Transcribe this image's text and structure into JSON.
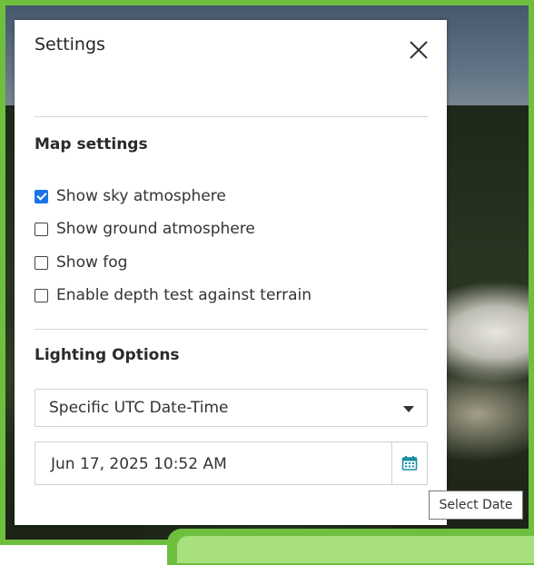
{
  "dialog": {
    "title": "Settings",
    "close_icon": "close-icon"
  },
  "map_settings": {
    "heading": "Map settings",
    "options": [
      {
        "label": "Show sky atmosphere",
        "checked": true
      },
      {
        "label": "Show ground atmosphere",
        "checked": false
      },
      {
        "label": "Show fog",
        "checked": false
      },
      {
        "label": "Enable depth test against terrain",
        "checked": false
      }
    ]
  },
  "lighting": {
    "heading": "Lighting Options",
    "mode_selected": "Specific UTC Date-Time",
    "date_value": "Jun 17, 2025 10:52 AM",
    "date_icon": "calendar-icon"
  },
  "tooltip": {
    "text": "Select Date"
  },
  "colors": {
    "accent_green": "#6fbf3f",
    "checkbox_blue": "#1a73e8",
    "calendar_icon": "#1b8ea6"
  }
}
